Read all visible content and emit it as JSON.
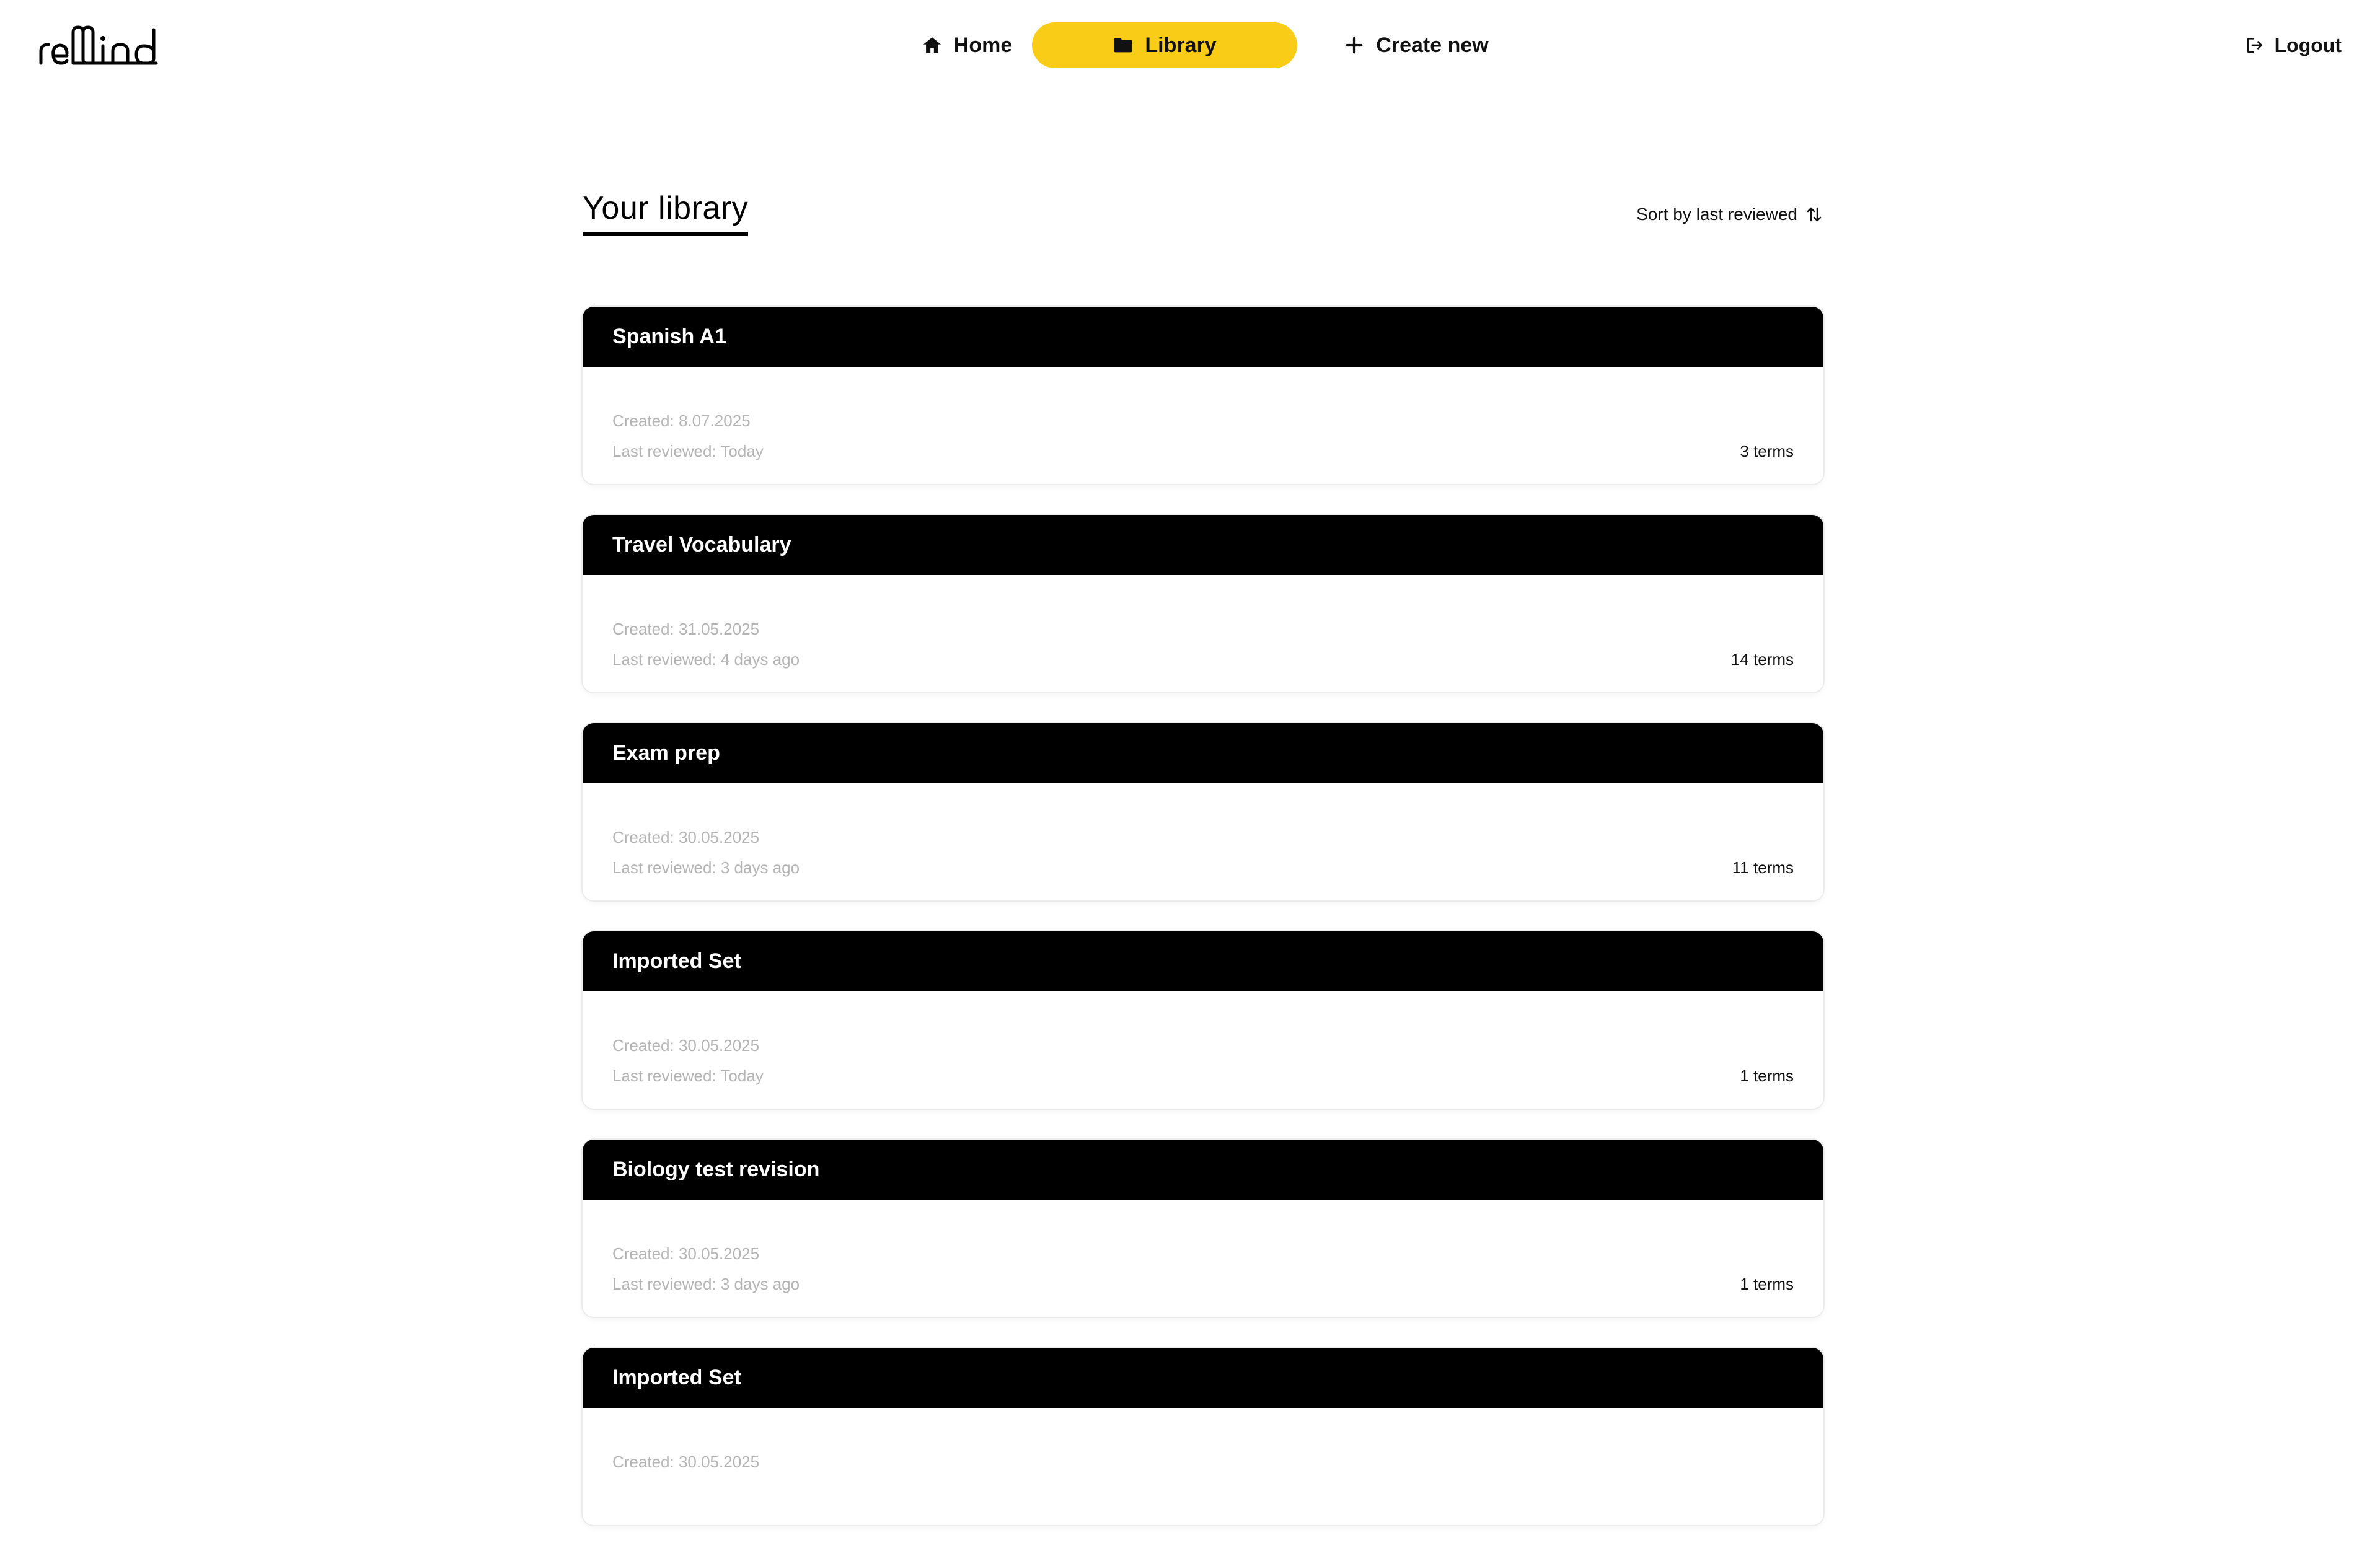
{
  "app": {
    "logo_text": "reMind"
  },
  "nav": {
    "items": [
      {
        "label": "Home",
        "icon": "home-icon"
      },
      {
        "label": "Library",
        "icon": "folder-icon",
        "active": true
      },
      {
        "label": "Create new",
        "icon": "plus-icon"
      }
    ],
    "logout_label": "Logout",
    "logout_icon": "logout-icon"
  },
  "library": {
    "title": "Your library",
    "sort_label": "Sort by last reviewed",
    "sort_icon": "sort-arrows-icon"
  },
  "sets": [
    {
      "title": "Spanish A1",
      "created": "Created: 8.07.2025",
      "last_reviewed": "Last reviewed: Today",
      "terms": "3 terms"
    },
    {
      "title": "Travel Vocabulary",
      "created": "Created: 31.05.2025",
      "last_reviewed": "Last reviewed: 4 days ago",
      "terms": "14 terms"
    },
    {
      "title": "Exam prep",
      "created": "Created: 30.05.2025",
      "last_reviewed": "Last reviewed: 3 days ago",
      "terms": "11 terms"
    },
    {
      "title": "Imported Set",
      "created": "Created: 30.05.2025",
      "last_reviewed": "Last reviewed: Today",
      "terms": "1 terms"
    },
    {
      "title": "Biology test revision",
      "created": "Created: 30.05.2025",
      "last_reviewed": "Last reviewed: 3 days ago",
      "terms": "1 terms"
    },
    {
      "title": "Imported Set",
      "created": "Created: 30.05.2025",
      "last_reviewed": "",
      "terms": ""
    }
  ],
  "colors": {
    "accent": "#f9cc17",
    "card_header": "#000000",
    "meta_text": "#b4b4b4"
  }
}
